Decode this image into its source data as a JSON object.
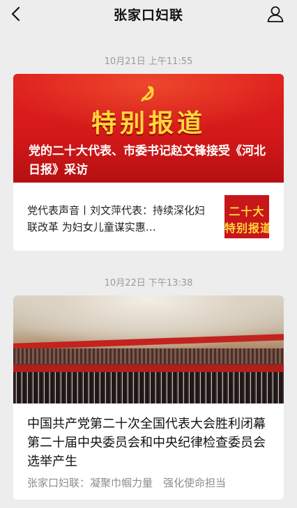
{
  "header": {
    "title": "张家口妇联",
    "back_icon": "chevron-left-icon",
    "profile_icon": "person-icon"
  },
  "messages": [
    {
      "timestamp": "10月21日 上午11:55",
      "banner": {
        "big_text": "特别报道",
        "headline": "党的二十大代表、市委书记赵文锋接受《河北日报》采访"
      },
      "sub_item": {
        "title": "党代表声音丨刘文萍代表：持续深化妇联改革 为妇女儿童谋实惠…",
        "thumb_line1": "二十大",
        "thumb_line2": "特别报道"
      }
    },
    {
      "timestamp": "10月22日 下午13:38",
      "article": {
        "title": "中国共产党第二十次全国代表大会胜利闭幕　第二十届中央委员会和中央纪律检查委员会选举产生",
        "subtitle": "张家口妇联：凝聚巾帼力量　强化使命担当"
      }
    }
  ],
  "colors": {
    "accent_red": "#d4191a",
    "gold": "#ffd83a",
    "timestamp_gray": "#9a9a9a"
  }
}
